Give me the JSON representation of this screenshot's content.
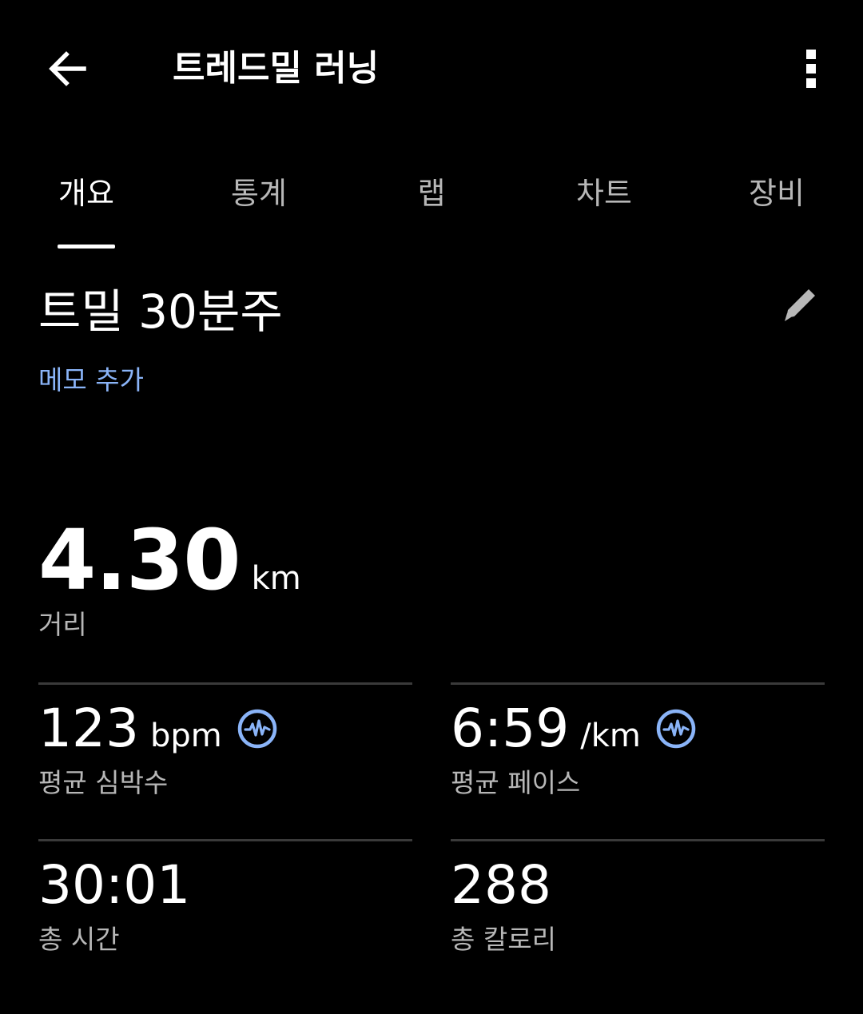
{
  "header": {
    "title": "트레드밀 러닝",
    "back_icon": "arrow-left-icon",
    "more_icon": "more-vertical-icon"
  },
  "tabs": [
    {
      "label": "개요",
      "active": true
    },
    {
      "label": "통계",
      "active": false
    },
    {
      "label": "랩",
      "active": false
    },
    {
      "label": "차트",
      "active": false
    },
    {
      "label": "장비",
      "active": false
    }
  ],
  "workout": {
    "title": "트밀 30분주",
    "edit_icon": "pencil-icon",
    "memo_link": "메모 추가"
  },
  "distance": {
    "value": "4.30",
    "unit": "km",
    "label": "거리"
  },
  "stats": {
    "heart_rate": {
      "value": "123",
      "unit": "bpm",
      "label": "평균 심박수",
      "icon": "heart-rate-wave-icon"
    },
    "pace": {
      "value": "6:59",
      "unit": "/km",
      "label": "평균 페이스",
      "icon": "heart-rate-wave-icon"
    },
    "total_time": {
      "value": "30:01",
      "label": "총 시간"
    },
    "calories": {
      "value": "288",
      "label": "총 칼로리"
    }
  },
  "colors": {
    "background": "#000000",
    "text_primary": "#ffffff",
    "text_secondary": "#b7b7b7",
    "accent": "#8ab4f8",
    "divider": "#3a3a3a"
  }
}
